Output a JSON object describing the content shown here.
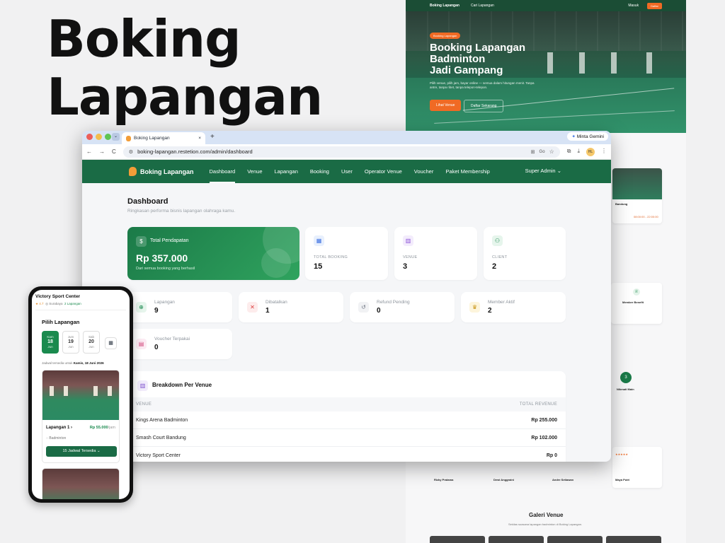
{
  "headline": {
    "line1": "Boking",
    "line2": "Lapangan"
  },
  "landing": {
    "nav_brand": "Boking Lapangan",
    "nav_link": "Cari Lapangan",
    "nav_login": "Masuk",
    "nav_register": "Daftar",
    "badge": "Booking Lapangan",
    "title_l1": "Booking Lapangan",
    "title_l2": "Badminton",
    "title_l3": "Jadi Gampang",
    "subtitle": "Pilih venue, pilih jam, bayar online — semua dalam hitungan menit. Tanpa antre, tanpa ribet, tanpa telepon-telepon.",
    "cta_primary": "Lihat Venue",
    "cta_secondary": "Daftar Sekarang",
    "card_bandung": "Bandung",
    "card_time": "08:00:00 - 22:00:00",
    "benefit_title": "Member Benefit",
    "step_number": "3",
    "step_title": "Nikmati Main",
    "stars": "★★★★★",
    "reviewers": [
      "Rizky Pratama",
      "Dewi Anggraini",
      "Andre Setiawan",
      "Maya Putri"
    ],
    "gallery_title": "Galeri Venue",
    "gallery_sub": "Sekilas suasana lapangan badminton di Boking Lapangan."
  },
  "browser": {
    "tab_title": "Boking Lapangan",
    "url": "boking-lapangan.restetion.com/admin/dashboard",
    "gemini": "Minta Gemini",
    "new_tab": "+",
    "nav_back": "←",
    "nav_forward": "→",
    "nav_reload": "C",
    "tab_close": "×",
    "tab_menu": "⌄",
    "url_lock": "⚙",
    "ext_icon": "⧉",
    "download_icon": "⤓",
    "avatar": "HL",
    "menu_icon": "⋮",
    "translate_icon": "⊞",
    "lens_icon": "Go",
    "star_icon": "☆"
  },
  "app": {
    "brand": "Boking Lapangan",
    "nav": [
      "Dashboard",
      "Venue",
      "Lapangan",
      "Booking",
      "User",
      "Operator Venue",
      "Voucher",
      "Paket Membership"
    ],
    "user_menu": "Super Admin",
    "title": "Dashboard",
    "subtitle": "Ringkasan performa bisnis lapangan olahraga kamu.",
    "revenue": {
      "label": "Total Pendapatan",
      "value": "Rp 357.000",
      "note": "Dari semua booking yang berhasil",
      "icon": "$"
    },
    "stats": [
      {
        "label": "TOTAL BOOKING",
        "value": "15",
        "icon": "▦"
      },
      {
        "label": "VENUE",
        "value": "3",
        "icon": "▥"
      },
      {
        "label": "CLIENT",
        "value": "2",
        "icon": "⚇"
      }
    ],
    "mini": [
      {
        "label": "Lapangan",
        "value": "9",
        "icon": "⊕"
      },
      {
        "label": "Dibatalkan",
        "value": "1",
        "icon": "✕"
      },
      {
        "label": "Refund Pending",
        "value": "0",
        "icon": "↺"
      },
      {
        "label": "Member Aktif",
        "value": "2",
        "icon": "♛"
      },
      {
        "label": "Voucher Terpakai",
        "value": "0",
        "icon": "▤"
      }
    ],
    "breakdown": {
      "title": "Breakdown Per Venue",
      "icon": "▥",
      "col_venue": "VENUE",
      "col_revenue": "TOTAL REVENUE",
      "rows": [
        {
          "venue": "Kings Arena Badminton",
          "revenue": "Rp 255.000"
        },
        {
          "venue": "Smash Court Bandung",
          "revenue": "Rp 102.000"
        },
        {
          "venue": "Victory Sport Center",
          "revenue": "Rp 0"
        }
      ]
    }
  },
  "mobile": {
    "venue": "Victory Sport Center",
    "rating": "★ 4.7",
    "city": "◎ Surabaya",
    "courts": "2 Lapangan",
    "section": "Pilih Lapangan",
    "dates": [
      {
        "day": "Kam",
        "num": "18",
        "month": "Jun"
      },
      {
        "day": "Jum",
        "num": "19",
        "month": "Jun"
      },
      {
        "day": "Sab",
        "num": "20",
        "month": "Jun"
      }
    ],
    "cal_icon": "▦",
    "info_prefix": "Jadwal tersedia untuk",
    "info_date": "Kamis, 18 Juni 2026",
    "court_name": "Lapangan 1",
    "court_chevron": "›",
    "court_price": "Rp 55.000",
    "court_price_unit": "/jam",
    "sport": "Badminton",
    "cta": "15 Jadwal Tersedia"
  }
}
